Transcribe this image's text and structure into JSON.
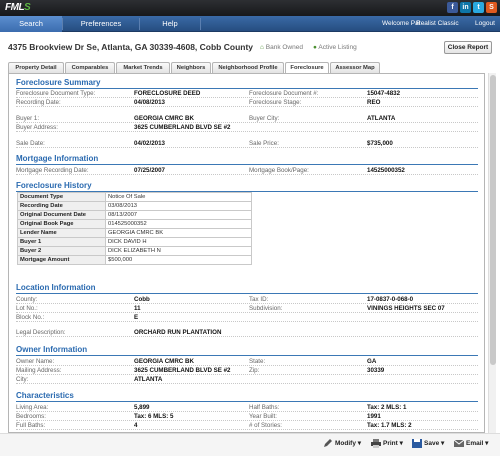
{
  "brand": {
    "logo_main": "FML",
    "logo_accent": "S"
  },
  "social": [
    "f",
    "in",
    "t",
    "S"
  ],
  "nav": {
    "items": [
      "Search",
      "Preferences",
      "Help"
    ],
    "welcome": "Welcome Pat",
    "realist": "Realist Classic",
    "logout": "Logout"
  },
  "header": {
    "address": "4375 Brookview Dr Se, Atlanta, GA 30339-4608, Cobb County",
    "bank_owned": "Bank Owned",
    "active_listing": "Active Listing",
    "close_report": "Close Report"
  },
  "tabs": [
    "Property Detail",
    "Comparables",
    "Market Trends",
    "Neighbors",
    "Neighborhood Profile",
    "Foreclosure",
    "Assessor Map"
  ],
  "foreclosure_summary": {
    "title": "Foreclosure Summary",
    "rows": [
      [
        "Foreclosure Document Type:",
        "FORECLOSURE DEED",
        "Foreclosure Document #:",
        "15047-4832"
      ],
      [
        "Recording Date:",
        "04/08/2013",
        "Foreclosure Stage:",
        "REO"
      ],
      [
        "Buyer 1:",
        "GEORGIA CMRC BK",
        "Buyer City:",
        "ATLANTA"
      ],
      [
        "Buyer Address:",
        "3625 CUMBERLAND BLVD SE #2",
        "",
        ""
      ],
      [
        "Sale Date:",
        "04/02/2013",
        "Sale Price:",
        "$735,000"
      ]
    ]
  },
  "mortgage": {
    "title": "Mortgage Information",
    "rows": [
      [
        "Mortgage Recording Date:",
        "07/25/2007",
        "Mortgage Book/Page:",
        "14525000352"
      ]
    ]
  },
  "history": {
    "title": "Foreclosure History",
    "rows": [
      [
        "Document Type",
        "Notice Of Sale"
      ],
      [
        "Recording Date",
        "03/08/2013"
      ],
      [
        "Original Document Date",
        "08/13/2007"
      ],
      [
        "Original Book Page",
        "014525000352"
      ],
      [
        "Lender Name",
        "GEORGIA CMRC BK"
      ],
      [
        "Buyer 1",
        "DICK DAVID H"
      ],
      [
        "Buyer 2",
        "DICK ELIZABETH N"
      ],
      [
        "Mortgage Amount",
        "$500,000"
      ]
    ]
  },
  "location": {
    "title": "Location Information",
    "rows": [
      [
        "County:",
        "Cobb",
        "Tax ID:",
        "17-0837-0-068-0"
      ],
      [
        "Lot No.:",
        "11",
        "Subdivision:",
        "VININGS HEIGHTS SEC 07"
      ],
      [
        "Block No.:",
        "E",
        "",
        ""
      ],
      [
        "Legal Description:",
        "ORCHARD RUN PLANTATION",
        "",
        ""
      ]
    ]
  },
  "owner": {
    "title": "Owner Information",
    "rows": [
      [
        "Owner Name:",
        "GEORGIA CMRC BK",
        "State:",
        "GA"
      ],
      [
        "Mailing Address:",
        "3625 CUMBERLAND BLVD SE #2",
        "Zip:",
        "30339"
      ],
      [
        "City:",
        "ATLANTA",
        "",
        ""
      ]
    ]
  },
  "characteristics": {
    "title": "Characteristics",
    "rows": [
      [
        "Living Area:",
        "5,899",
        "Half Baths:",
        "Tax: 2 MLS: 1"
      ],
      [
        "Bedrooms:",
        "Tax: 6 MLS: 5",
        "Year Built:",
        "1991"
      ],
      [
        "Full Baths:",
        "4",
        "# of Stories:",
        "Tax: 1.7 MLS: 2"
      ]
    ]
  },
  "footer": {
    "modify": "Modify",
    "print": "Print",
    "save": "Save",
    "email": "Email"
  },
  "colors": {
    "nav": "#264d80",
    "section": "#2a6ab0",
    "green": "#5fb846"
  }
}
